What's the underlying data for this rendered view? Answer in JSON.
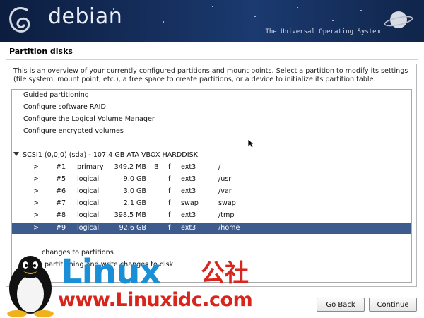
{
  "banner": {
    "brand": "debian",
    "tagline": "The Universal Operating System"
  },
  "page": {
    "title": "Partition disks",
    "description": "This is an overview of your currently configured partitions and mount points. Select a partition to modify its settings (file system, mount point, etc.), a free space to create partitions, or a device to initialize its partition table."
  },
  "menu": [
    "Guided partitioning",
    "Configure software RAID",
    "Configure the Logical Volume Manager",
    "Configure encrypted volumes"
  ],
  "disk": {
    "label": "SCSI1 (0,0,0) (sda) - 107.4 GB ATA VBOX HARDDISK"
  },
  "partitions": [
    {
      "arrow": ">",
      "num": "#1",
      "type": "primary",
      "size": "349.2 MB",
      "boot": "B",
      "fmt": "f",
      "fs": "ext3",
      "mount": "/"
    },
    {
      "arrow": ">",
      "num": "#5",
      "type": "logical",
      "size": "9.0 GB",
      "boot": "",
      "fmt": "f",
      "fs": "ext3",
      "mount": "/usr"
    },
    {
      "arrow": ">",
      "num": "#6",
      "type": "logical",
      "size": "3.0 GB",
      "boot": "",
      "fmt": "f",
      "fs": "ext3",
      "mount": "/var"
    },
    {
      "arrow": ">",
      "num": "#7",
      "type": "logical",
      "size": "2.1 GB",
      "boot": "",
      "fmt": "f",
      "fs": "swap",
      "mount": "swap"
    },
    {
      "arrow": ">",
      "num": "#8",
      "type": "logical",
      "size": "398.5 MB",
      "boot": "",
      "fmt": "f",
      "fs": "ext3",
      "mount": "/tmp"
    },
    {
      "arrow": ">",
      "num": "#9",
      "type": "logical",
      "size": "92.6 GB",
      "boot": "",
      "fmt": "f",
      "fs": "ext3",
      "mount": "/home"
    }
  ],
  "actions": {
    "undo": "changes to partitions",
    "finish": "partitioning and write changes to disk"
  },
  "buttons": {
    "back": "Go Back",
    "continue": "Continue"
  },
  "watermark": {
    "word": "Linux",
    "cn": "公社",
    "url": "www.Linuxidc.com"
  }
}
